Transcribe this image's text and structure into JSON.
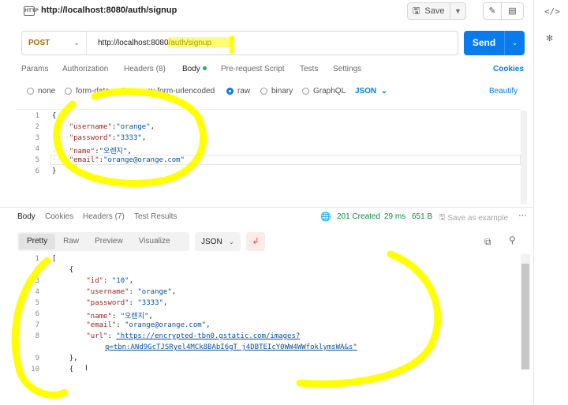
{
  "tab": {
    "badge": "HTTP",
    "title": "http://localhost:8080/auth/signup"
  },
  "toolbar": {
    "save_label": "Save"
  },
  "request": {
    "method": "POST",
    "url": "http://localhost:8080/auth/signup",
    "send_label": "Send",
    "tabs": [
      {
        "label": "Params"
      },
      {
        "label": "Authorization"
      },
      {
        "label": "Headers (8)"
      },
      {
        "label": "Body"
      },
      {
        "label": "Pre-request Script"
      },
      {
        "label": "Tests"
      },
      {
        "label": "Settings"
      }
    ],
    "cookies_label": "Cookies",
    "body_types": [
      "none",
      "form-data",
      "x-www-form-urlencoded",
      "raw",
      "binary",
      "GraphQL"
    ],
    "selected_body_type": "raw",
    "language": "JSON",
    "beautify_label": "Beautify",
    "body_lines": [
      {
        "n": "1",
        "text": "{"
      },
      {
        "n": "2",
        "key": "\"username\"",
        "value": "\"orange\"",
        "trail": ","
      },
      {
        "n": "3",
        "key": "\"password\"",
        "value": "\"3333\"",
        "trail": ","
      },
      {
        "n": "4",
        "key": "\"name\"",
        "value": "\"오렌지\"",
        "trail": ","
      },
      {
        "n": "5",
        "key": "\"email\"",
        "value": "\"orange@orange.com\"",
        "trail": ""
      },
      {
        "n": "6",
        "text": "}"
      }
    ]
  },
  "response": {
    "tabs": [
      {
        "label": "Body"
      },
      {
        "label": "Cookies"
      },
      {
        "label": "Headers (7)"
      },
      {
        "label": "Test Results"
      }
    ],
    "status": "201 Created",
    "time": "29 ms",
    "size": "651 B",
    "save_example_label": "Save as example",
    "view_modes": [
      "Pretty",
      "Raw",
      "Preview",
      "Visualize"
    ],
    "language": "JSON",
    "lines": [
      {
        "n": "1",
        "text": "["
      },
      {
        "n": "2",
        "text": "{"
      },
      {
        "n": "3",
        "key": "\"id\"",
        "value": "\"10\"",
        "trail": ","
      },
      {
        "n": "4",
        "key": "\"username\"",
        "value": "\"orange\"",
        "trail": ","
      },
      {
        "n": "5",
        "key": "\"password\"",
        "value": "\"3333\"",
        "trail": ","
      },
      {
        "n": "6",
        "key": "\"name\"",
        "value": "\"오렌지\"",
        "trail": ","
      },
      {
        "n": "7",
        "key": "\"email\"",
        "value": "\"orange@orange.com\"",
        "trail": ","
      },
      {
        "n": "8",
        "key": "\"url\"",
        "value": "\"https://encrypted-tbn0.gstatic.com/images?",
        "cont": "q=tbn:ANd9GcTJSRyel4MCk8BAbI6gT_j4DBTEIcY0WW4WWfoklymsWA&s\""
      },
      {
        "n": "9",
        "text": "},"
      },
      {
        "n": "10",
        "text": "{"
      }
    ]
  },
  "colors": {
    "accent": "#097bed",
    "highlight": "#ffff00",
    "success": "#0d8a3f",
    "method": "#a36b00"
  }
}
